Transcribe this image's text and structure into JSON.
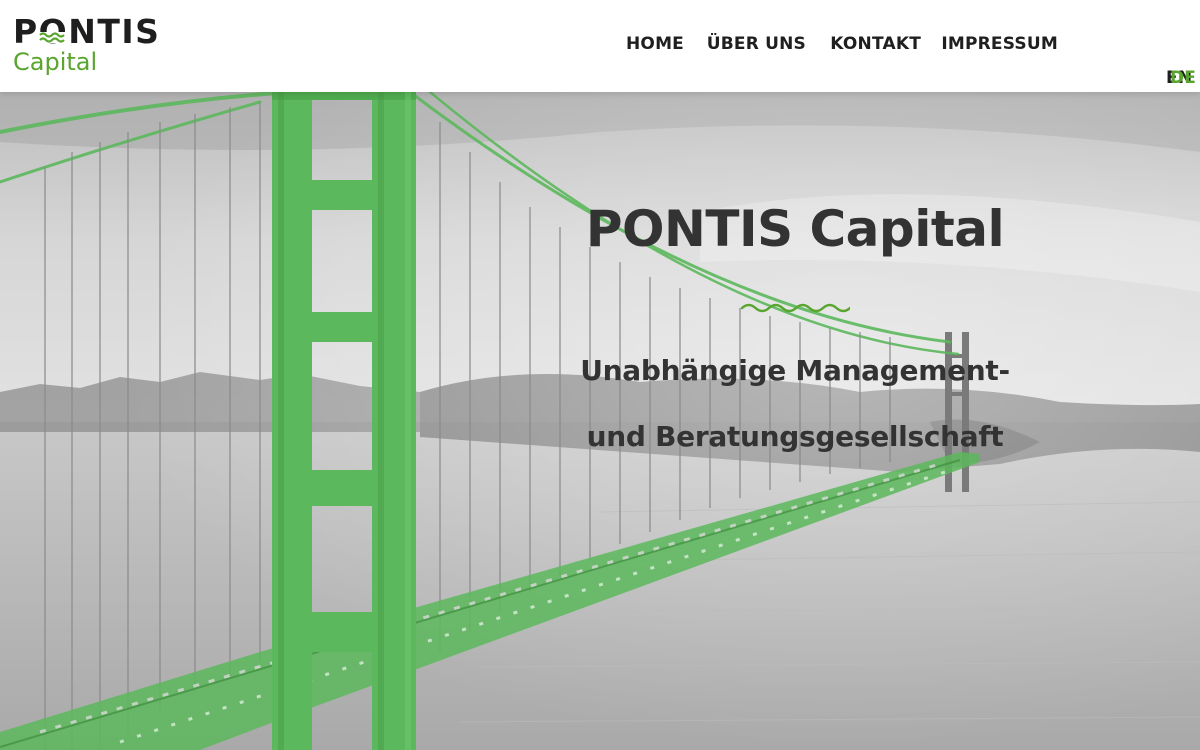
{
  "brand": {
    "name": "PONTIS",
    "tagline": "Capital",
    "accent_color": "#5aa52e"
  },
  "nav": {
    "items": [
      {
        "label": "HOME"
      },
      {
        "label": "ÜBER UNS"
      },
      {
        "label": "KONTAKT"
      },
      {
        "label": "IMPRESSUM"
      }
    ]
  },
  "language": {
    "options": [
      "EN",
      "DE"
    ],
    "active": "DE"
  },
  "hero": {
    "title": "PONTIS Capital",
    "subtitle_line1": "Unabhängige Management-",
    "subtitle_line2": "und Beratungsgesellschaft",
    "background": "golden-gate-bridge-photo",
    "divider_icon": "wave-divider-icon"
  }
}
